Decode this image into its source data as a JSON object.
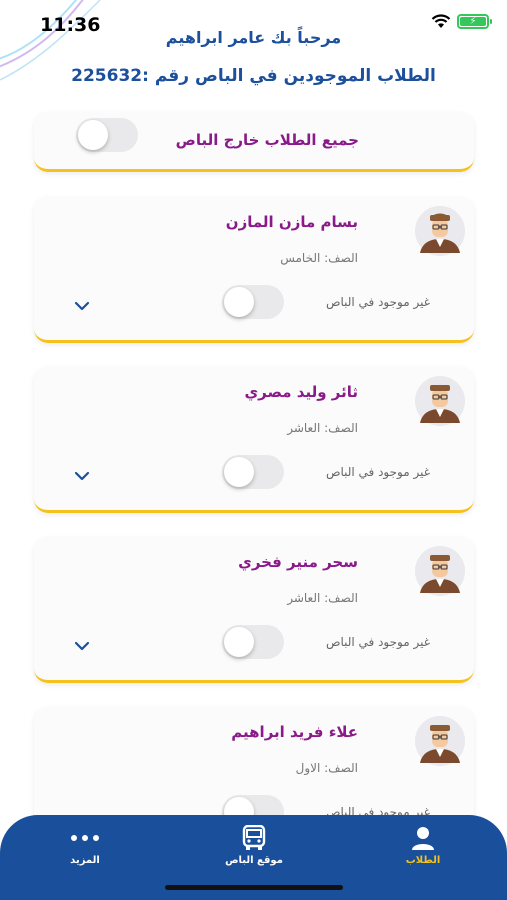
{
  "status": {
    "time": "11:36"
  },
  "header": {
    "greeting": "مرحباً بك عامر ابراهيم",
    "bus_line": "الطلاب الموجودين في الباص رقم :225632"
  },
  "all_students": {
    "label": "جميع الطلاب خارج الباص",
    "toggle_on": false
  },
  "students": [
    {
      "name": "بسام مازن المازن",
      "grade": "الصف: الخامس",
      "status": "غير موجود في الباص",
      "in_bus": false
    },
    {
      "name": "ثائر وليد مصري",
      "grade": "الصف: العاشر",
      "status": "غير موجود في الباص",
      "in_bus": false
    },
    {
      "name": "سحر منير فخري",
      "grade": "الصف: العاشر",
      "status": "غير موجود في الباص",
      "in_bus": false
    },
    {
      "name": "علاء فريد ابراهيم",
      "grade": "الصف: الاول",
      "status": "غير موجود في الباص",
      "in_bus": false
    }
  ],
  "tabbar": {
    "more": "المزيد",
    "bus_location": "موقع الباص",
    "students": "الطلاب"
  },
  "colors": {
    "primary": "#1c4f9c",
    "name": "#8a1a8a",
    "accent": "#f5c21b"
  }
}
